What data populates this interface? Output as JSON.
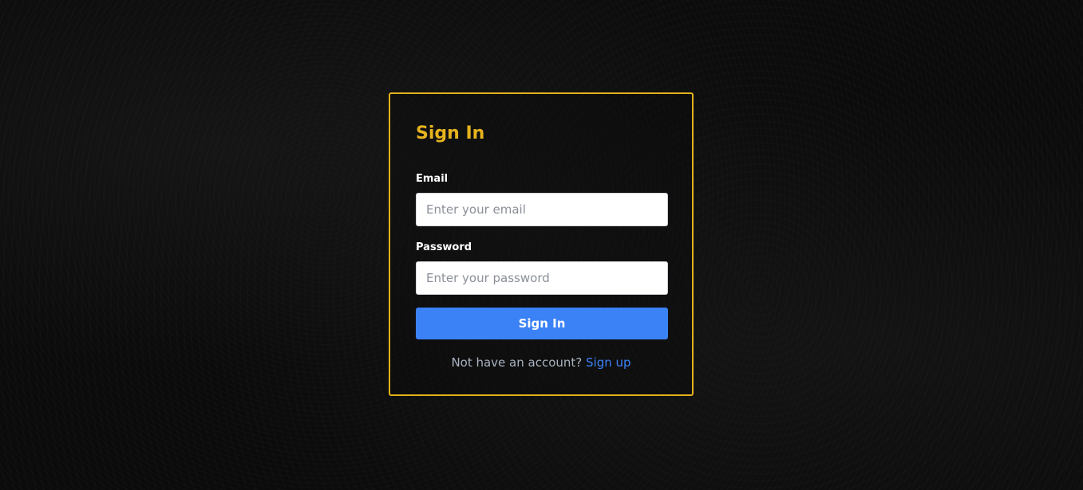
{
  "signin": {
    "title": "Sign In",
    "email": {
      "label": "Email",
      "placeholder": "Enter your email",
      "value": ""
    },
    "password": {
      "label": "Password",
      "placeholder": "Enter your password",
      "value": ""
    },
    "submit_label": "Sign In",
    "footer": {
      "text": "Not have an account?",
      "link_label": "Sign up"
    }
  },
  "colors": {
    "accent": "#e3b21c",
    "primary": "#3b82f6",
    "background": "#0b0b0b"
  }
}
